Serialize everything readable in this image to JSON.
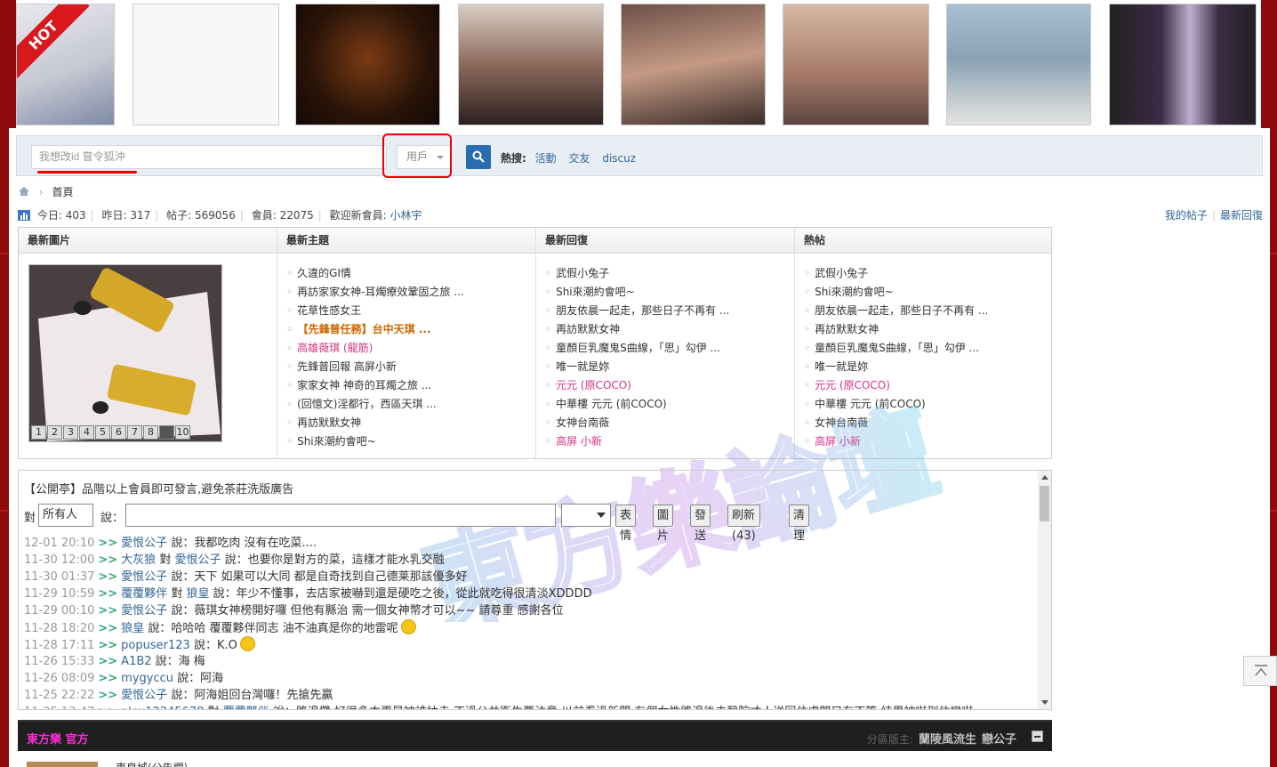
{
  "banner": {
    "hot_label": "HOT",
    "thumbs": [
      {
        "left": 0,
        "color": "#c9ccd4"
      },
      {
        "left": 0,
        "color": "#f4f4f4"
      },
      {
        "left": 0,
        "color": "#3a2416"
      },
      {
        "left": 0,
        "color": "#b89c88"
      },
      {
        "left": 0,
        "color": "#8b6a60"
      },
      {
        "left": 0,
        "color": "#a07e70"
      },
      {
        "left": 0,
        "color": "#9fb4c4"
      },
      {
        "left": 0,
        "color": "#3d3040"
      }
    ]
  },
  "search": {
    "placeholder": "我想改id  嘗令狐沖",
    "type": "用戶",
    "hot_label": "熱搜:",
    "hot_links": [
      "活動",
      "交友",
      "discuz"
    ]
  },
  "breadcrumb": {
    "home": "首頁"
  },
  "stats": {
    "today_label": "今日:",
    "today": "403",
    "yesterday_label": "昨日:",
    "yesterday": "317",
    "posts_label": "帖子:",
    "posts": "569056",
    "members_label": "會員:",
    "members": "22075",
    "welcome_label": "歡迎新會員:",
    "newest_member": "小林宇",
    "my_posts": "我的帖子",
    "latest_replies": "最新回復"
  },
  "portal": {
    "col_images": "最新圖片",
    "col_topics": "最新主題",
    "col_replies": "最新回復",
    "col_hot": "熱帖",
    "pager": [
      "1",
      "2",
      "3",
      "4",
      "5",
      "6",
      "7",
      "8",
      "9",
      "10"
    ],
    "topics": [
      {
        "text": "久違的GI情",
        "style": ""
      },
      {
        "text": "再訪家家女神-耳燭療效鞏固之旅 ...",
        "style": ""
      },
      {
        "text": "花草性感女王",
        "style": ""
      },
      {
        "text": "【先鋒普任務】台中天琪 ...",
        "style": "orange"
      },
      {
        "text": "高雄薇琪 (龍筋)",
        "style": "pink"
      },
      {
        "text": "先鋒普回報 高屏小新",
        "style": ""
      },
      {
        "text": "家家女神 神奇的耳燭之旅 ...",
        "style": ""
      },
      {
        "text": "(回憶文)淫都行，西區天琪 ...",
        "style": ""
      },
      {
        "text": "再訪默默女神",
        "style": ""
      },
      {
        "text": "Shi來潮約會吧~",
        "style": ""
      }
    ],
    "replies": [
      {
        "text": "武假小兔子",
        "style": ""
      },
      {
        "text": "Shi來潮約會吧~",
        "style": ""
      },
      {
        "text": "朋友依晨一起走，那些日子不再有 ...",
        "style": ""
      },
      {
        "text": "再訪默默女神",
        "style": ""
      },
      {
        "text": "童顏巨乳魔鬼S曲線，「思」勾伊 ...",
        "style": ""
      },
      {
        "text": "唯一就是妳",
        "style": ""
      },
      {
        "text": "元元 (原COCO)",
        "style": "pink"
      },
      {
        "text": "中華樓 元元 (前COCO)",
        "style": ""
      },
      {
        "text": "女神台南薇",
        "style": ""
      },
      {
        "text": "高屏 小新",
        "style": "pink"
      }
    ],
    "hot": [
      {
        "text": "武假小兔子",
        "style": ""
      },
      {
        "text": "Shi來潮約會吧~",
        "style": ""
      },
      {
        "text": "朋友依晨一起走，那些日子不再有 ...",
        "style": ""
      },
      {
        "text": "再訪默默女神",
        "style": ""
      },
      {
        "text": "童顏巨乳魔鬼S曲線，「思」勾伊 ...",
        "style": ""
      },
      {
        "text": "唯一就是妳",
        "style": ""
      },
      {
        "text": "元元 (原COCO)",
        "style": "pink"
      },
      {
        "text": "中華樓 元元 (前COCO)",
        "style": ""
      },
      {
        "text": "女神台南薇",
        "style": ""
      },
      {
        "text": "高屏 小新",
        "style": "pink"
      }
    ]
  },
  "chat": {
    "title": "【公開亭】品階以上會員即可發言,避免茶莊洗版廣告",
    "to_label": "對",
    "to_value": "所有人",
    "say_label": "說：",
    "btn_emoji": "表情",
    "btn_image": "圖片",
    "btn_send": "發送",
    "btn_refresh": "刷新 (43)",
    "btn_clear": "清理",
    "messages": [
      {
        "time": "12-01 20:10",
        "user": "愛恨公子",
        "to": "",
        "text": "說：我都吃肉 沒有在吃菜....",
        "emoji": false
      },
      {
        "time": "11-30 12:00",
        "user": "大灰狼",
        "to": "愛恨公子",
        "text": "說：也要你是對方的菜，這樣才能水乳交融",
        "emoji": false
      },
      {
        "time": "11-30 01:37",
        "user": "愛恨公子",
        "to": "",
        "text": "說：天下 如果可以大同 都是自奇找到自己德莱那該優多好",
        "emoji": false
      },
      {
        "time": "11-29 10:59",
        "user": "覆覆夥伴",
        "to": "狼皇",
        "text": "說：年少不懂事，去店家被嚇到還是硬吃之後，從此就吃得很清淡XDDDD",
        "emoji": false
      },
      {
        "time": "11-29 00:10",
        "user": "愛恨公子",
        "to": "",
        "text": "說：薇琪女神榜開好囉 但他有縣治 需一個女神幣才可以~~ 請尊重 感謝各位",
        "emoji": false
      },
      {
        "time": "11-28 18:20",
        "user": "狼皇",
        "to": "",
        "text": "說：哈哈哈 覆覆夥伴同志 油不油真是你的地雷呢",
        "emoji": true
      },
      {
        "time": "11-28 17:11",
        "user": "popuser123",
        "to": "",
        "text": "說：K.O",
        "emoji": true
      },
      {
        "time": "11-26 15:33",
        "user": "A1B2",
        "to": "",
        "text": "說：海 梅",
        "emoji": false
      },
      {
        "time": "11-26 08:09",
        "user": "mygyccu",
        "to": "",
        "text": "說：阿海",
        "emoji": false
      },
      {
        "time": "11-25 22:22",
        "user": "愛恨公子",
        "to": "",
        "text": "說：阿海姐回台灣囉！先搶先贏",
        "emoji": false
      },
      {
        "time": "11-25 13:47",
        "user": "alex12345678",
        "to": "覆覆夥伴",
        "text": "說：路邊攤 好很多本更是被誰抽走 不過公共衛生要注意 以前看過新聞 有個女性路邊後去醫院才人送回住處問只有不等 結果被嚇到住蠻嚇",
        "emoji": false
      }
    ],
    "to_word": "對"
  },
  "forum": {
    "name": "東方樂 官方",
    "mods_label": "分區版主:",
    "mod1": "蘭陵風流生",
    "mod2": "戀公子",
    "first_row": "東皇城(公告欄)"
  },
  "watermark": "東方樂論壇"
}
